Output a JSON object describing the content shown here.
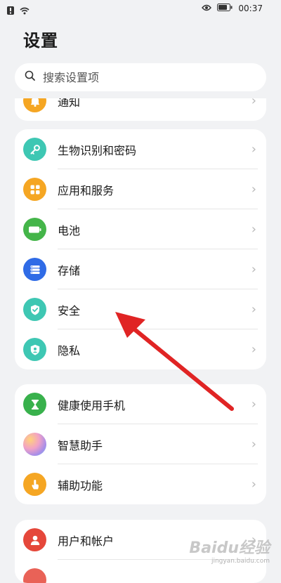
{
  "status_bar": {
    "time": "00:37",
    "battery_icon": "battery-icon",
    "eye_icon": "eye-icon",
    "wifi_icon": "wifi-icon"
  },
  "header": {
    "title": "设置"
  },
  "search": {
    "placeholder": "搜索设置项",
    "icon": "search-icon"
  },
  "colors": {
    "accent_arrow": "#e02424",
    "background": "#f1f2f4",
    "card": "#ffffff"
  },
  "partial_item": {
    "label": "通知",
    "icon": "bell-icon",
    "color": "#f5a623"
  },
  "group1": [
    {
      "label": "生物识别和密码",
      "icon": "key-icon",
      "color": "#3ec7b3"
    },
    {
      "label": "应用和服务",
      "icon": "apps-icon",
      "color": "#f5a623"
    },
    {
      "label": "电池",
      "icon": "battery-icon",
      "color": "#44b549"
    },
    {
      "label": "存储",
      "icon": "storage-icon",
      "color": "#2f6be6"
    },
    {
      "label": "安全",
      "icon": "shield-icon",
      "color": "#3ec7b3"
    },
    {
      "label": "隐私",
      "icon": "privacy-icon",
      "color": "#3ec7b3"
    }
  ],
  "group2": [
    {
      "label": "健康使用手机",
      "icon": "hourglass-icon",
      "color": "#38b14c"
    },
    {
      "label": "智慧助手",
      "icon": "assistant-icon",
      "color": "#a98ee8"
    },
    {
      "label": "辅助功能",
      "icon": "hand-icon",
      "color": "#f5a623"
    }
  ],
  "group3": [
    {
      "label": "用户和帐户",
      "icon": "user-icon",
      "color": "#e5473a"
    }
  ],
  "watermark": {
    "line1": "Baidu经验",
    "line2": "jingyan.baidu.com"
  }
}
